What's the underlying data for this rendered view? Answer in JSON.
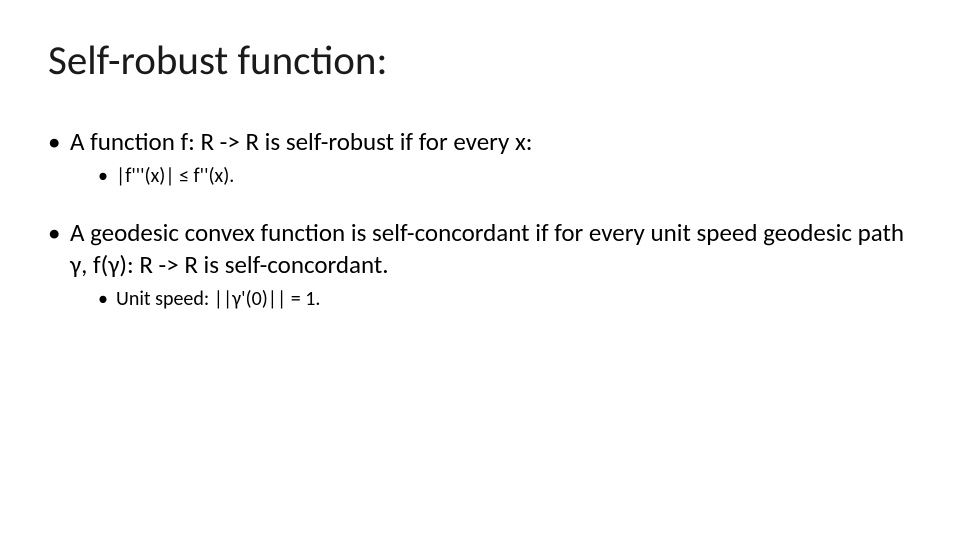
{
  "title": "Self-robust function:",
  "bullets": {
    "b1": "A function f: R -> R is self-robust if for every x:",
    "b1_sub": "|f'''(x)| ≤   f''(x).",
    "b2": "A geodesic convex function is self-concordant if for every unit speed geodesic path γ, f(γ): R -> R is self-concordant.",
    "b2_sub": "Unit speed: ||γ'(0)|| = 1."
  }
}
